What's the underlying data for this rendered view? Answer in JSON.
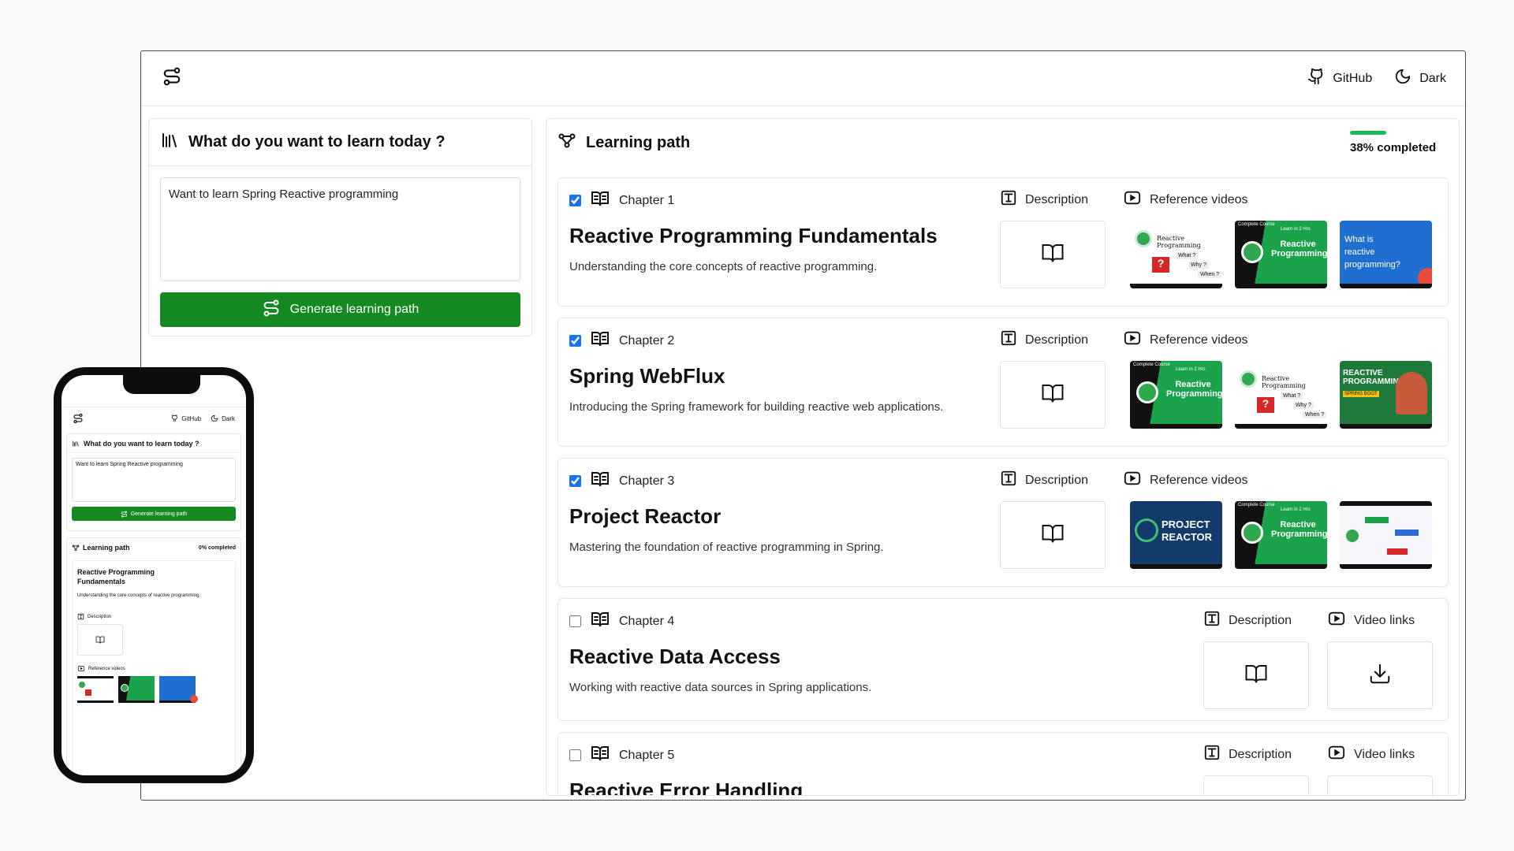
{
  "topbar": {
    "github_label": "GitHub",
    "theme_label": "Dark"
  },
  "prompt_panel": {
    "title": "What do you want to learn today ?",
    "input_value": "Want to learn Spring Reactive programming",
    "button_label": "Generate learning path"
  },
  "path_panel": {
    "title": "Learning path",
    "completed_label": "38% completed",
    "completed_fraction": 0.38
  },
  "chapters": [
    {
      "number_label": "Chapter 1",
      "checked": true,
      "title": "Reactive Programming Fundamentals",
      "description": "Understanding the core concepts of reactive programming.",
      "desc_label": "Description",
      "videos_label": "Reference videos"
    },
    {
      "number_label": "Chapter 2",
      "checked": true,
      "title": "Spring WebFlux",
      "description": "Introducing the Spring framework for building reactive web applications.",
      "desc_label": "Description",
      "videos_label": "Reference videos"
    },
    {
      "number_label": "Chapter 3",
      "checked": true,
      "title": "Project Reactor",
      "description": "Mastering the foundation of reactive programming in Spring.",
      "desc_label": "Description",
      "videos_label": "Reference videos"
    },
    {
      "number_label": "Chapter 4",
      "checked": false,
      "title": "Reactive Data Access",
      "description": "Working with reactive data sources in Spring applications.",
      "desc_label": "Description",
      "videos_label": "Video links"
    },
    {
      "number_label": "Chapter 5",
      "checked": false,
      "title": "Reactive Error Handling",
      "description": "",
      "desc_label": "Description",
      "videos_label": "Video links"
    }
  ],
  "thumbnails": {
    "reactive_programming": "Reactive Programming",
    "what_why_when": [
      "What ?",
      "Why ?",
      "When ?"
    ],
    "complete_course": "Complete Course",
    "learn_in_2_hrs": "Learn in 2 Hrs",
    "what_is_reactive": "What is reactive programming?",
    "reactive_programming_caps": "REACTIVE PROGRAMMING",
    "spring_boot": "SPRING BOOT",
    "project_reactor": "PROJECT REACTOR"
  },
  "phone": {
    "github_label": "GitHub",
    "theme_label": "Dark",
    "prompt_title": "What do you want to learn today ?",
    "input_value": "Want to learn Spring Reactive programming",
    "button_label": "Generate learning path",
    "path_title": "Learning path",
    "completed_label": "0% completed",
    "chapter_title": "Reactive Programming Fundamentals",
    "chapter_desc": "Understanding the core concepts of reactive programming.",
    "desc_label": "Description",
    "videos_label": "Reference videos"
  },
  "colors": {
    "primary_button": "#168a22",
    "progress": "#1db954",
    "checkbox": "#1a73e8"
  }
}
